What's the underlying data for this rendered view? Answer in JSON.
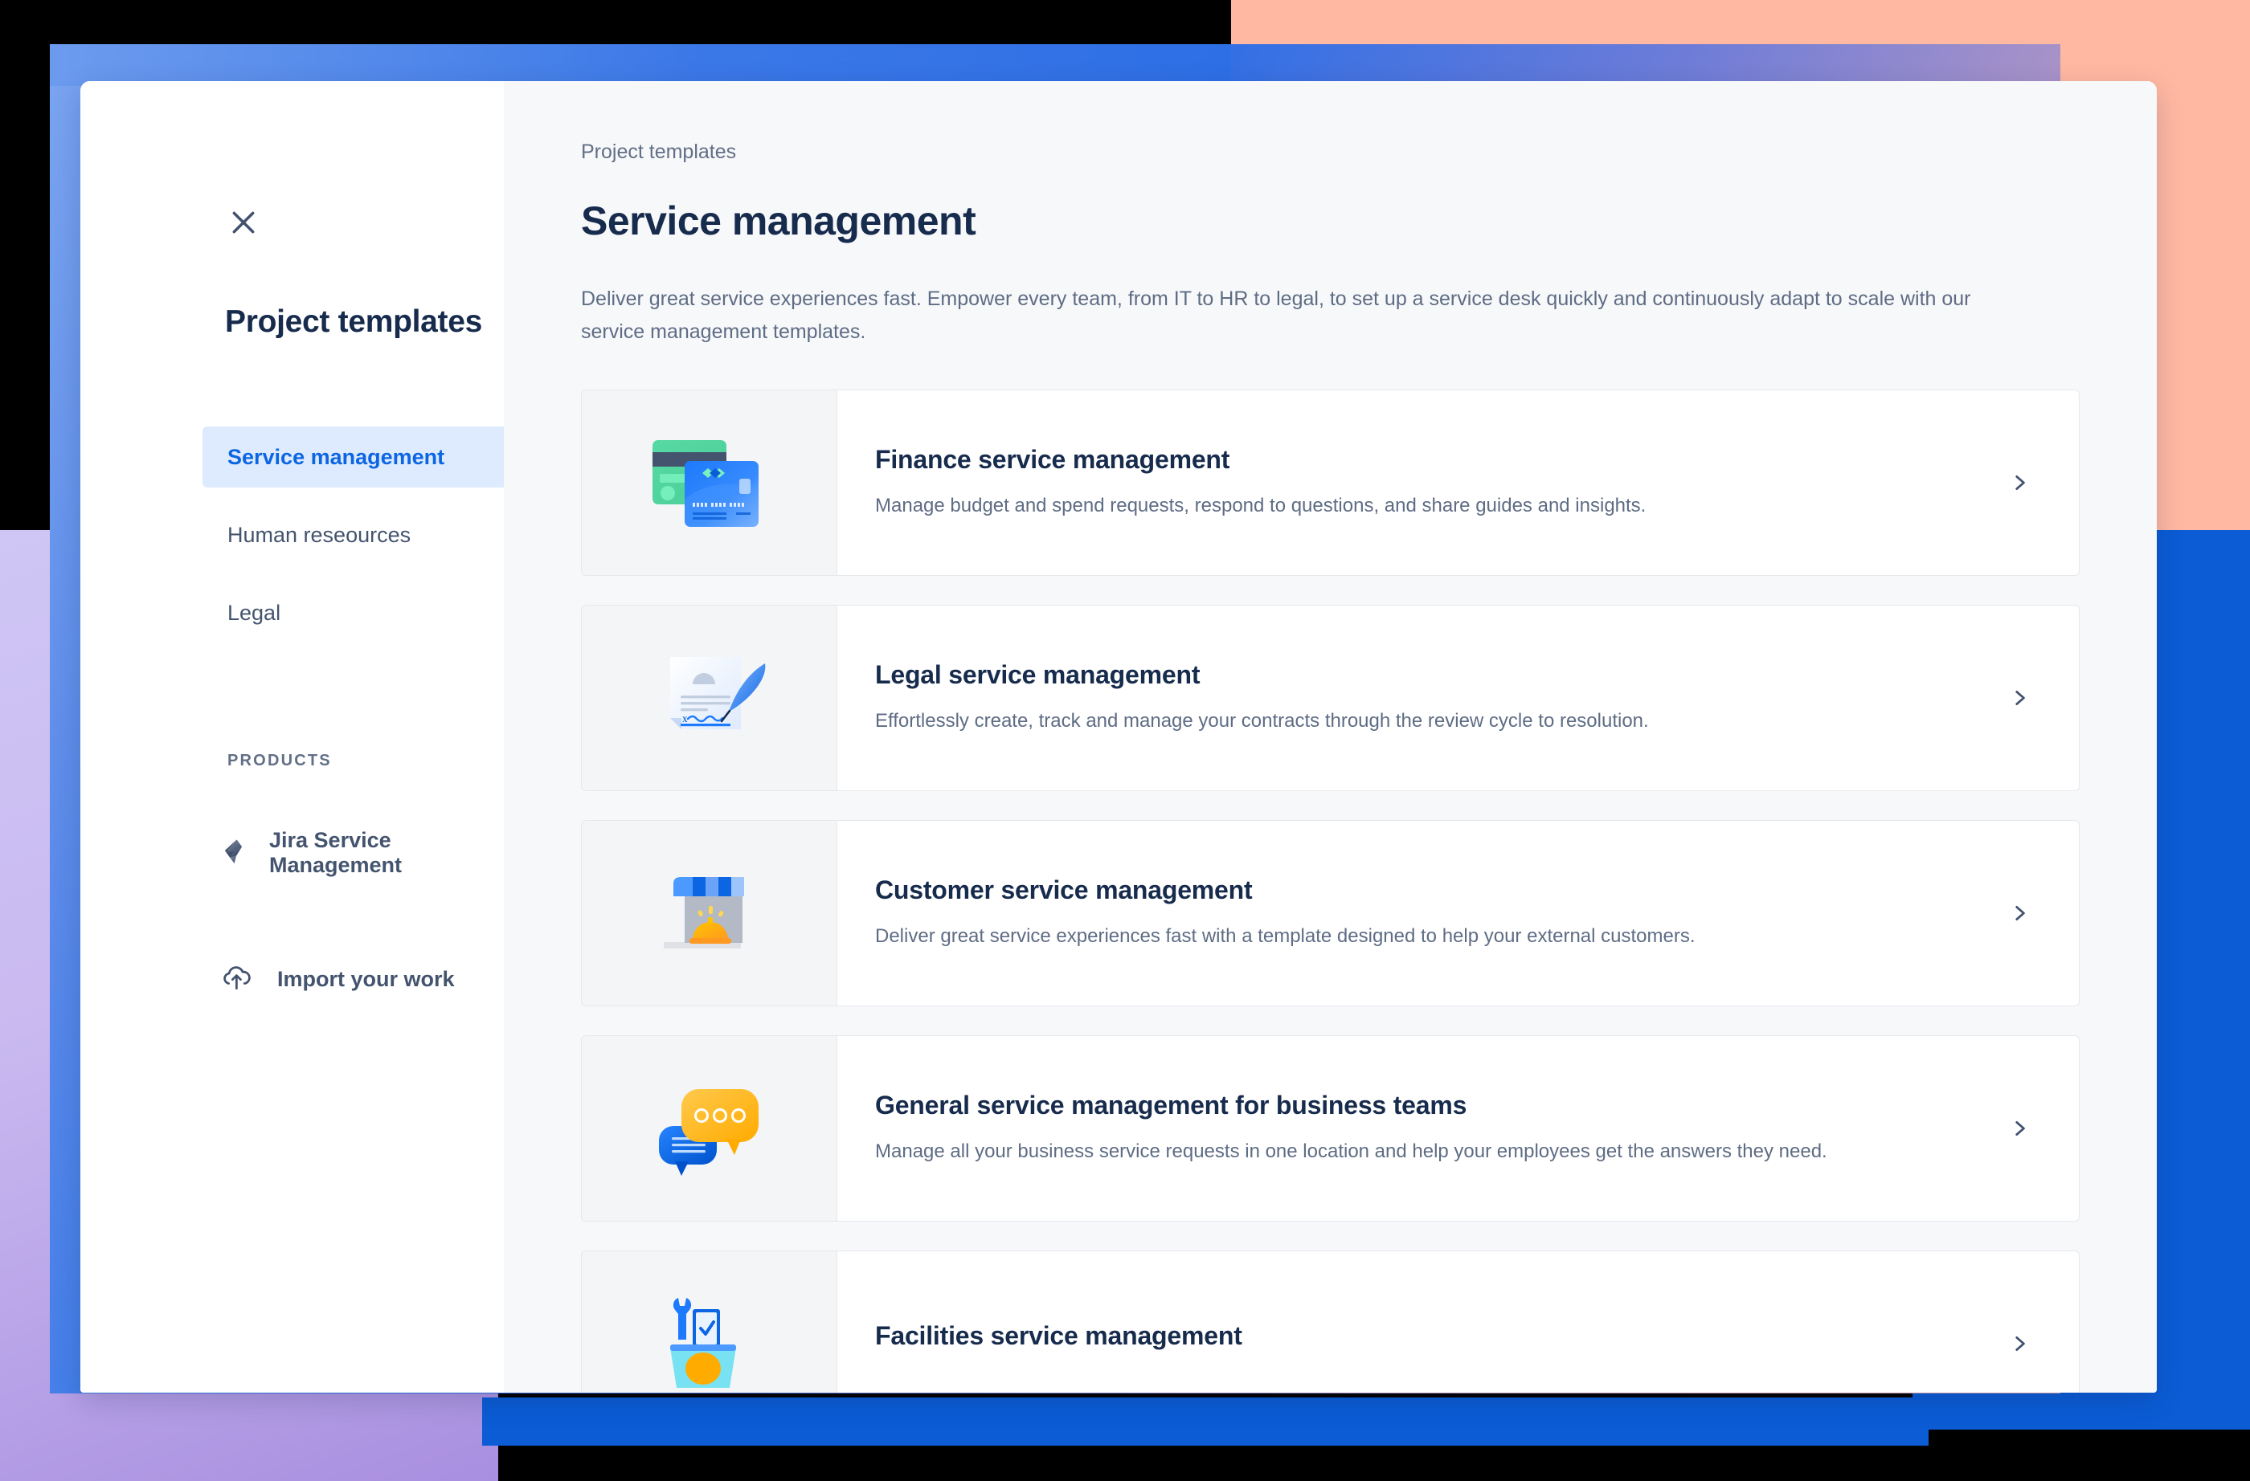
{
  "colors": {
    "accent_blue": "#0C66E4",
    "nav_active_bg": "#DEEAFD",
    "text_dark": "#172B4D",
    "text_muted": "#5E6C84",
    "panel_bg": "#F7F8FA",
    "deco_peach": "#FFB8A2",
    "deco_blue": "#0B5CD5",
    "deco_lilac": "#C9B9F0"
  },
  "sidebar": {
    "close_icon": "close-icon",
    "title": "Project templates",
    "nav_items": [
      {
        "label": "Service management",
        "active": true
      },
      {
        "label": "Human reseources",
        "active": false
      },
      {
        "label": "Legal",
        "active": false
      }
    ],
    "products_header": "PRODUCTS",
    "products": [
      {
        "label": "Jira Service Management",
        "icon": "jira-service-management-icon"
      }
    ],
    "import": {
      "label": "Import your work",
      "icon": "cloud-upload-icon"
    }
  },
  "main": {
    "breadcrumb": "Project templates",
    "title": "Service management",
    "description": "Deliver great service experiences fast. Empower every team, from IT to HR to legal, to set up a service desk quickly and continuously adapt to scale with our service management templates.",
    "chevron_icon": "chevron-right-icon",
    "cards": [
      {
        "title": "Finance service management",
        "description": "Manage budget and spend requests, respond to questions, and share guides and insights.",
        "icon": "credit-cards-icon",
        "card_digits": "0000 0000 0000 0000"
      },
      {
        "title": "Legal service management",
        "description": "Effortlessly create, track and manage your contracts through the review cycle to resolution.",
        "icon": "contract-signature-quill-icon"
      },
      {
        "title": "Customer service management",
        "description": "Deliver great service experiences fast with a template designed to help your external customers.",
        "icon": "storefront-service-bell-icon"
      },
      {
        "title": "General service management for business teams",
        "description": "Manage all your business service requests in one location and help your employees get the answers they need.",
        "icon": "speech-bubbles-icon"
      },
      {
        "title": "Facilities service management",
        "description": "",
        "icon": "wrench-clipboard-icon"
      }
    ]
  }
}
